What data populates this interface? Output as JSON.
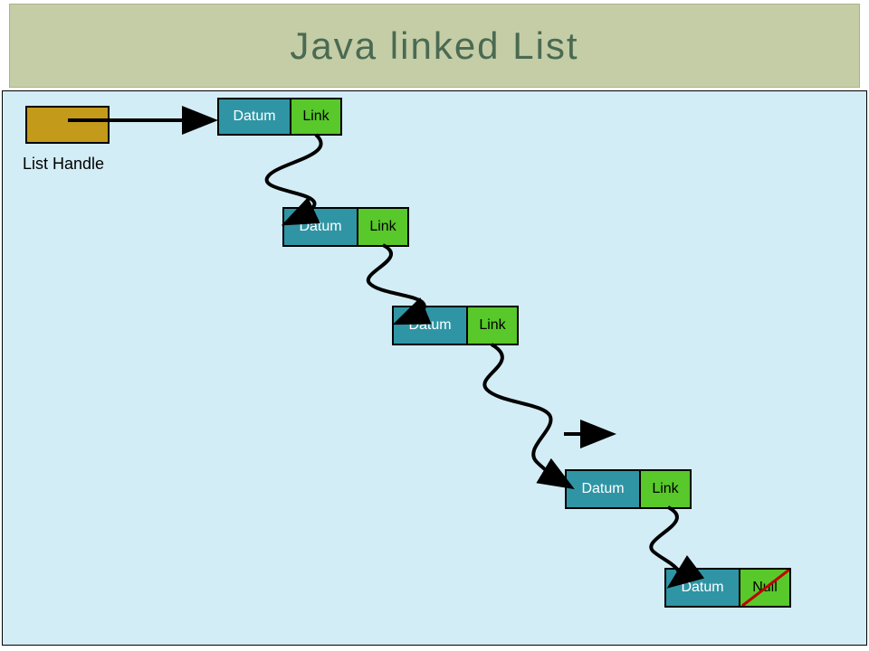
{
  "title": "Java  linked  List",
  "handle_label": "List Handle",
  "nodes": [
    {
      "datum": "Datum",
      "link": "Link",
      "null": false
    },
    {
      "datum": "Datum",
      "link": "Link",
      "null": false
    },
    {
      "datum": "Datum",
      "link": "Link",
      "null": false
    },
    {
      "datum": "Datum",
      "link": "Link",
      "null": false
    },
    {
      "datum": "Datum",
      "link": "Null",
      "null": true
    }
  ]
}
